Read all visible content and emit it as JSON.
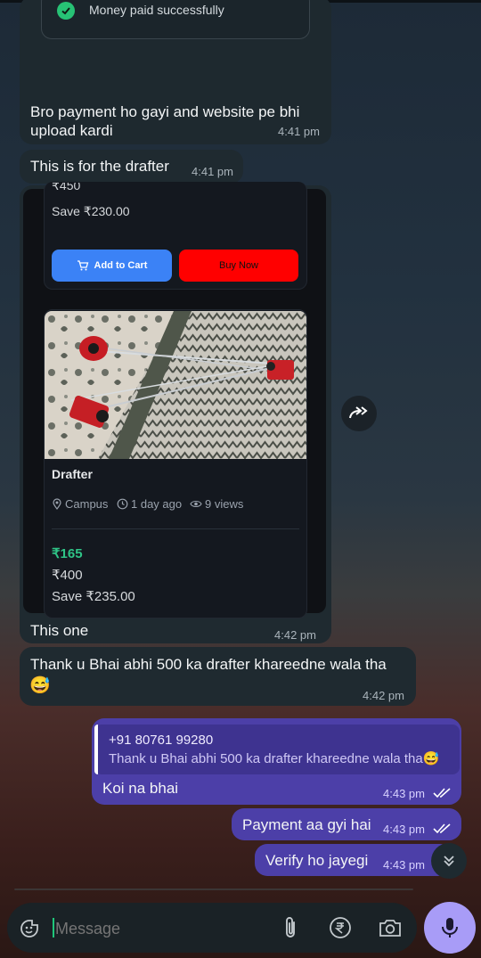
{
  "messages": {
    "m1": {
      "card_text": "Money paid successfully",
      "text": "Bro payment ho gayi and website pe bhi upload kardi",
      "time": "4:41 pm"
    },
    "m2": {
      "text": "This is for the drafter",
      "time": "4:41 pm"
    },
    "m3": {
      "product_top": {
        "price_partial": "₹450",
        "save": "Save ₹230.00",
        "add_to_cart": "Add to Cart",
        "buy_now": "Buy Now"
      },
      "product": {
        "title": "Drafter",
        "location": "Campus",
        "posted": "1 day ago",
        "views": "9 views",
        "price": "₹165",
        "original_price": "₹400",
        "save": "Save ₹235.00"
      },
      "caption": "This one",
      "time": "4:42 pm"
    },
    "m4": {
      "text": "Thank u Bhai abhi 500 ka drafter khareedne wala tha",
      "emoji": "😅",
      "time": "4:42 pm"
    },
    "m5": {
      "quote_author": "+91 80761 99280",
      "quote_text": "Thank u Bhai abhi 500 ka drafter khareedne wala tha😅",
      "text": "Koi na bhai",
      "time": "4:43 pm"
    },
    "m6": {
      "text": "Payment aa gyi hai",
      "time": "4:43 pm"
    },
    "m7": {
      "text": "Verify ho jayegi",
      "time": "4:43 pm"
    }
  },
  "composer": {
    "placeholder": "Message"
  },
  "icons": [
    "check-circle-icon",
    "cart-icon",
    "location-pin-icon",
    "clock-icon",
    "eye-icon",
    "forward-icon",
    "double-check-icon",
    "scroll-down-icon",
    "emoji-icon",
    "attach-icon",
    "rupee-icon",
    "camera-icon",
    "mic-icon"
  ],
  "colors": {
    "outgoing": "#4c3fa8",
    "incoming": "#1f2a30",
    "accent_green": "#27c275",
    "mic": "#a89cf7"
  }
}
